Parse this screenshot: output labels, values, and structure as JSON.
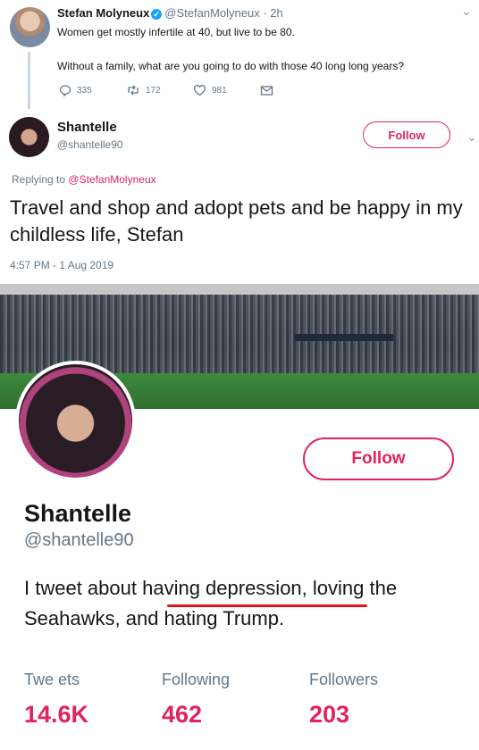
{
  "original_tweet": {
    "name": "Stefan Molyneux",
    "handle_time": "@StefanMolyneux · 2h",
    "line1": "Women get mostly infertile at 40, but live to be 80.",
    "line2": "Without a family, what are you going to do with those 40 long long years?",
    "replies": "335",
    "retweets": "172",
    "likes": "981"
  },
  "reply_tweet": {
    "name": "Shantelle",
    "handle": "@shantelle90",
    "follow_label": "Follow",
    "replying_prefix": "Replying to",
    "replying_to": "@StefanMolyneux",
    "text": "Travel and shop and adopt pets and be happy in my childless life, Stefan",
    "timestamp": "4:57 PM - 1 Aug 2019"
  },
  "profile": {
    "name": "Shantelle",
    "handle": "@shantelle90",
    "follow_label": "Follow",
    "bio_before": "I tweet about ",
    "bio_underlined": "having depression",
    "bio_after": ", loving the Seahawks, and hating Trump.",
    "stats": {
      "tweets_label": "Twe ets",
      "tweets_value": "14.6K",
      "following_label": "Following",
      "following_value": "462",
      "followers_label": "Followers",
      "followers_value": "203"
    }
  },
  "colors": {
    "accent": "#e0245e",
    "verified": "#1da1f2",
    "muted": "#657786",
    "underline": "#e0141e"
  }
}
